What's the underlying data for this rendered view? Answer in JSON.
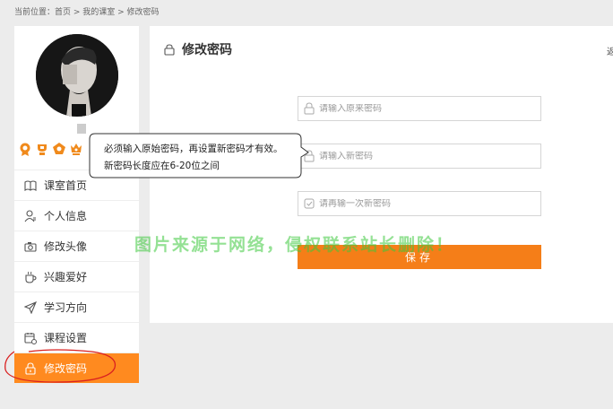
{
  "breadcrumb": "当前位置：首页 > 我的课室 > 修改密码",
  "sidebar": {
    "badges": [
      "medal-icon",
      "trophy-icon",
      "award-icon",
      "crown-icon"
    ],
    "items": [
      {
        "label": "课室首页",
        "icon": "book-icon"
      },
      {
        "label": "个人信息",
        "icon": "user-icon"
      },
      {
        "label": "修改头像",
        "icon": "camera-icon"
      },
      {
        "label": "兴趣爱好",
        "icon": "cup-icon"
      },
      {
        "label": "学习方向",
        "icon": "send-icon"
      },
      {
        "label": "课程设置",
        "icon": "calendar-icon"
      },
      {
        "label": "修改密码",
        "icon": "lock-icon",
        "active": true
      }
    ]
  },
  "main": {
    "title": "修改密码",
    "back_link": "返",
    "fields": {
      "old_password": {
        "placeholder": "请输入原来密码"
      },
      "new_password": {
        "placeholder": "请输入新密码"
      },
      "confirm_password": {
        "placeholder": "请再输一次新密码"
      }
    },
    "save_label": "保存"
  },
  "tooltip": {
    "line1": "必须输入原始密码，再设置新密码才有效。",
    "line2": "新密码长度应在6-20位之间"
  },
  "watermark": "图片来源于网络，侵权联系站长删除！",
  "colors": {
    "accent": "#ff8a1f",
    "button": "#f57e18",
    "background": "#ececec",
    "annotation": "#d92020"
  }
}
